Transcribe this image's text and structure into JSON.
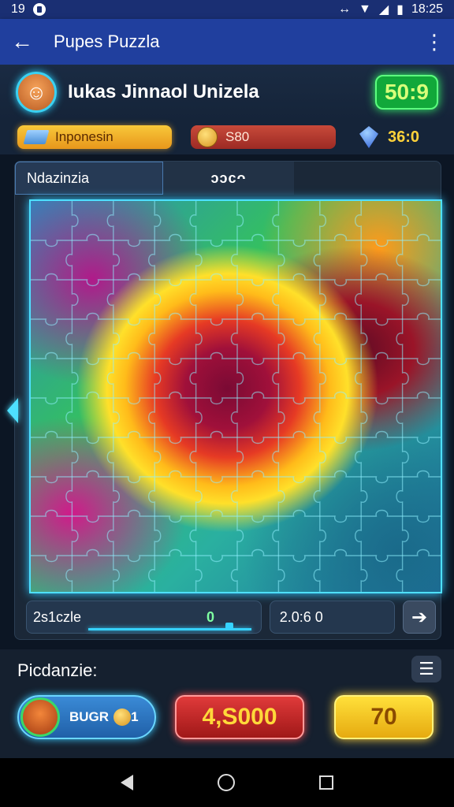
{
  "status_bar": {
    "time_left": "19",
    "time_right": "18:25"
  },
  "app_bar": {
    "title": "Pupes Puzzla",
    "back_icon": "arrow-left-icon",
    "menu_icon": "more-vert-icon"
  },
  "player": {
    "name": "Iukas Jinnaol Unizela",
    "timer": "50:9"
  },
  "info": {
    "country": "Inponesin",
    "coins": "S80",
    "gems": "36:0"
  },
  "board": {
    "tab_left": "Ndazinzia",
    "tab_right": "ᴐᴐᴄᴖ",
    "progress_label": "2s1czle",
    "progress_value": "0",
    "progress_fraction": 0.85,
    "score": "2.0:6 0",
    "next_icon": "arrow-right-icon"
  },
  "bottom": {
    "label": "Picdanzie:",
    "boost_label": "BUGR",
    "boost_suffix": "1",
    "coins_button": "4,S000",
    "gold_button": "70"
  },
  "colors": {
    "accent": "#4ee0ff",
    "app_bar": "#203f9e",
    "timer": "#11a83a"
  }
}
